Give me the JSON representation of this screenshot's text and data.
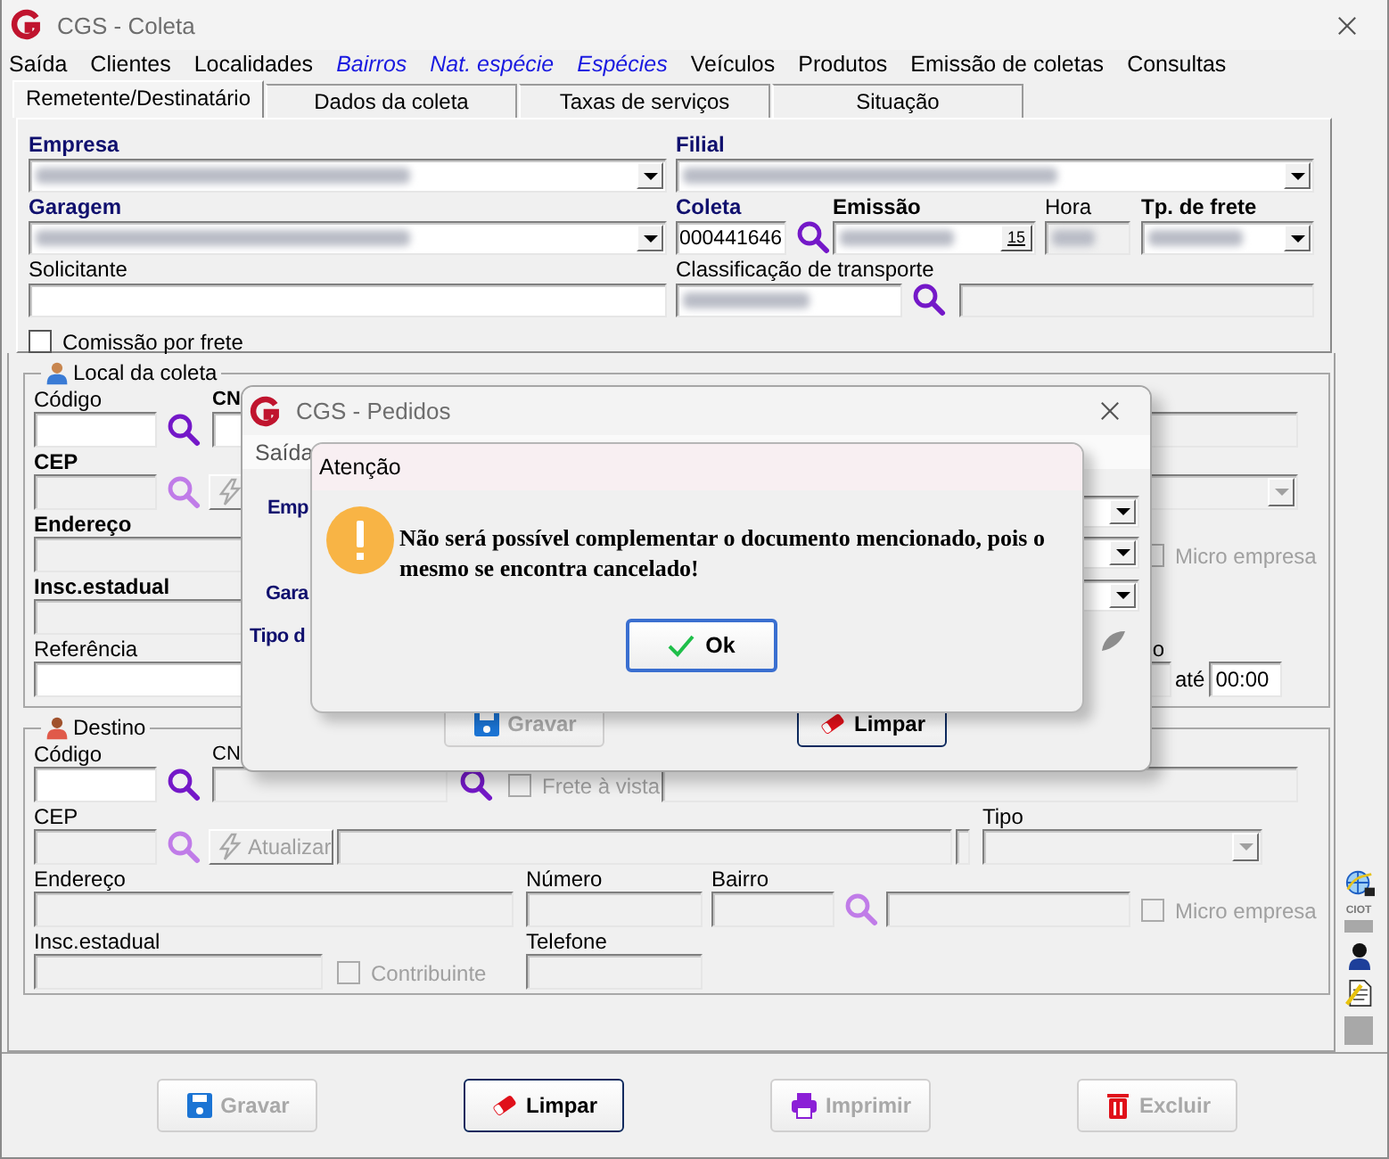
{
  "window": {
    "title": "CGS - Coleta"
  },
  "menu": [
    {
      "label": "Saída",
      "kind": "plain"
    },
    {
      "label": "Clientes",
      "kind": "plain"
    },
    {
      "label": "Localidades",
      "kind": "plain"
    },
    {
      "label": "Bairros",
      "kind": "link"
    },
    {
      "label": "Nat. espécie",
      "kind": "link"
    },
    {
      "label": "Espécies",
      "kind": "link"
    },
    {
      "label": "Veículos",
      "kind": "plain"
    },
    {
      "label": "Produtos",
      "kind": "plain"
    },
    {
      "label": "Emissão de coletas",
      "kind": "plain"
    },
    {
      "label": "Consultas",
      "kind": "plain"
    }
  ],
  "tabs": [
    {
      "label": "Remetente/Destinatário",
      "selected": true
    },
    {
      "label": "Dados da coleta",
      "selected": false
    },
    {
      "label": "Taxas de serviços",
      "selected": false
    },
    {
      "label": "Situação",
      "selected": false
    }
  ],
  "header": {
    "empresa": {
      "label": "Empresa",
      "kind": "required",
      "redacted": true
    },
    "filial": {
      "label": "Filial",
      "kind": "required",
      "redacted": true
    },
    "garagem": {
      "label": "Garagem",
      "kind": "required",
      "redacted": true
    },
    "coleta": {
      "label": "Coleta",
      "kind": "required",
      "value": "000441646"
    },
    "emissao": {
      "label": "Emissão",
      "kind": "bold",
      "redacted": true,
      "calendar": "15"
    },
    "hora": {
      "label": "Hora",
      "kind": "normal",
      "redacted": true,
      "disabled": true
    },
    "tp_frete": {
      "label": "Tp. de frete",
      "kind": "bold",
      "redacted": true
    },
    "solicitante": {
      "label": "Solicitante",
      "kind": "normal"
    },
    "classificacao": {
      "label": "Classificação de transporte",
      "kind": "normal",
      "redacted": true
    },
    "classificacao_desc": {
      "disabled": true
    },
    "comissao": {
      "label": "Comissão por frete",
      "checked": false
    }
  },
  "local_coleta": {
    "title": "Local da coleta",
    "codigo": {
      "label": "Código",
      "kind": "normal"
    },
    "cn": {
      "label": "CN",
      "kind": "bold"
    },
    "cn_desc": {
      "disabled": true
    },
    "cep": {
      "label": "CEP",
      "kind": "bold",
      "disabled": true
    },
    "tipo": {
      "disabled": true
    },
    "endereco": {
      "label": "Endereço",
      "kind": "bold",
      "disabled": true
    },
    "micro": {
      "label": "Micro empresa",
      "checked": false,
      "disabled": true
    },
    "insc": {
      "label": "Insc.estadual",
      "kind": "bold",
      "disabled": true
    },
    "referencia": {
      "label": "Referência",
      "kind": "normal"
    },
    "periodo": {
      "label": "o",
      "kind": "normal",
      "disabled": true
    },
    "ate": {
      "label": "até",
      "value": "00:00"
    }
  },
  "destino": {
    "title": "Destino",
    "codigo": {
      "label": "Código",
      "kind": "normal"
    },
    "cn": {
      "label": "CN",
      "kind": "normal",
      "disabled": true
    },
    "frete": {
      "label": "Frete à vista",
      "checked": false,
      "disabled": true
    },
    "cn_desc": {
      "disabled": true
    },
    "cep": {
      "label": "CEP",
      "kind": "normal",
      "disabled": true
    },
    "atualizar": {
      "label": "Atualizar",
      "disabled": true
    },
    "logradouro": {
      "disabled": true
    },
    "uf": {
      "disabled": true
    },
    "tipo": {
      "label": "Tipo",
      "kind": "normal",
      "disabled": true
    },
    "endereco": {
      "label": "Endereço",
      "kind": "normal",
      "disabled": true
    },
    "numero": {
      "label": "Número",
      "kind": "normal",
      "disabled": true
    },
    "bairro": {
      "label": "Bairro",
      "kind": "normal",
      "disabled": true
    },
    "bairro_desc": {
      "disabled": true
    },
    "micro": {
      "label": "Micro empresa",
      "checked": false,
      "disabled": true
    },
    "insc": {
      "label": "Insc.estadual",
      "kind": "normal",
      "disabled": true
    },
    "contribuinte": {
      "label": "Contribuinte",
      "checked": false,
      "disabled": true
    },
    "telefone": {
      "label": "Telefone",
      "kind": "normal",
      "disabled": true
    }
  },
  "side_tools": [
    {
      "kind": "globe"
    },
    {
      "kind": "ciot",
      "label": "CIOT"
    },
    {
      "kind": "person"
    },
    {
      "kind": "document"
    },
    {
      "kind": "blank"
    }
  ],
  "buttons": [
    {
      "label": "Gravar",
      "kind": "save",
      "disabled": true,
      "default": false
    },
    {
      "label": "Limpar",
      "kind": "eraser",
      "disabled": false,
      "default": true
    },
    {
      "label": "Imprimir",
      "kind": "print",
      "disabled": true,
      "default": false
    },
    {
      "label": "Excluir",
      "kind": "trash",
      "disabled": true,
      "default": false
    }
  ],
  "pedidos_window": {
    "title": "CGS - Pedidos",
    "menu": [
      "Saída"
    ],
    "labels": [
      "Emp",
      "Gara",
      "Tipo d"
    ],
    "buttons": [
      {
        "label": "Gravar",
        "kind": "save",
        "disabled": true,
        "default": false
      },
      {
        "label": "Limpar",
        "kind": "eraser",
        "disabled": false,
        "default": true
      }
    ]
  },
  "alert": {
    "title": "Atenção",
    "message": "Não será possível complementar o documento mencionado, pois o mesmo se encontra cancelado!",
    "button": "Ok"
  }
}
